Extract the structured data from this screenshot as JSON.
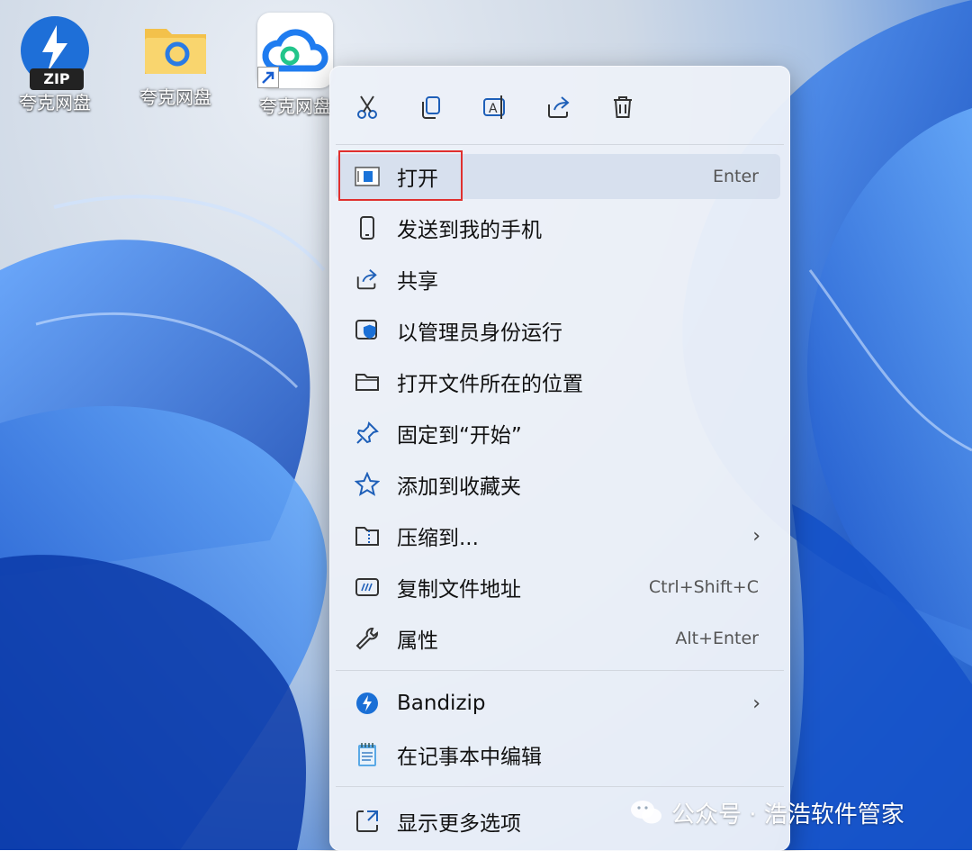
{
  "desktop": {
    "icons": [
      {
        "label": "夸克网盘",
        "badge": "ZIP"
      },
      {
        "label": "夸克网盘"
      },
      {
        "label": "夸克网盘"
      }
    ]
  },
  "context_menu": {
    "toolbar": [
      "cut-icon",
      "copy-icon",
      "rename-icon",
      "share-icon",
      "delete-icon"
    ],
    "items": [
      {
        "label": "打开",
        "hint": "Enter",
        "icon": "open-app-icon"
      },
      {
        "label": "发送到我的手机",
        "icon": "phone-icon"
      },
      {
        "label": "共享",
        "icon": "share-icon"
      },
      {
        "label": "以管理员身份运行",
        "icon": "admin-shield-icon"
      },
      {
        "label": "打开文件所在的位置",
        "icon": "folder-icon"
      },
      {
        "label": "固定到“开始”",
        "icon": "pin-icon"
      },
      {
        "label": "添加到收藏夹",
        "icon": "star-icon"
      },
      {
        "label": "压缩到...",
        "icon": "zip-folder-icon",
        "chevron": "›"
      },
      {
        "label": "复制文件地址",
        "hint": "Ctrl+Shift+C",
        "icon": "copy-path-icon"
      },
      {
        "label": "属性",
        "hint": "Alt+Enter",
        "icon": "wrench-icon"
      },
      {
        "label": "Bandizip",
        "icon": "bandizip-icon",
        "chevron": "›"
      },
      {
        "label": "在记事本中编辑",
        "icon": "notepad-icon"
      },
      {
        "label": "显示更多选项",
        "icon": "more-options-icon"
      }
    ]
  },
  "watermark": {
    "text": "公众号 · 浩浩软件管家"
  },
  "colors": {
    "accent": "#0067c0",
    "highlight_border": "#e0302e"
  }
}
